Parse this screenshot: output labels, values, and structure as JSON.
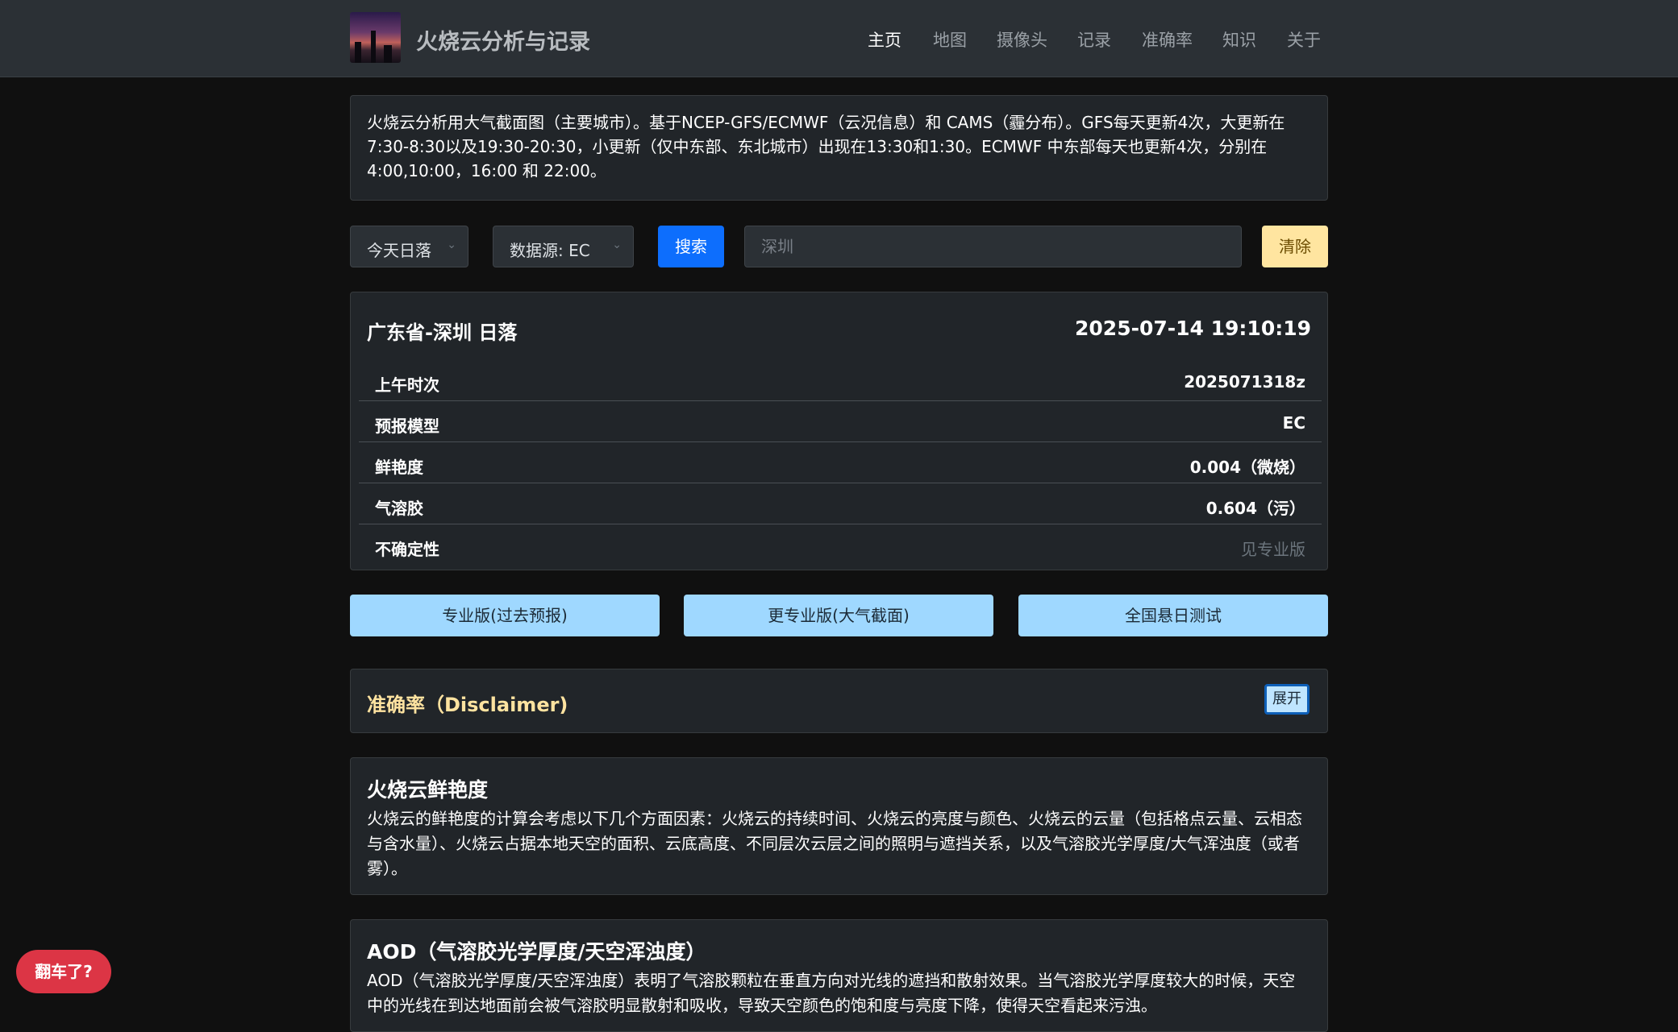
{
  "nav": {
    "brand": "火烧云分析与记录",
    "items": [
      "主页",
      "地图",
      "摄像头",
      "记录",
      "准确率",
      "知识",
      "关于"
    ],
    "active": "主页"
  },
  "intro": "火烧云分析用大气截面图（主要城市）。基于NCEP-GFS/ECMWF（云况信息）和 CAMS（霾分布）。GFS每天更新4次，大更新在7:30-8:30以及19:30-20:30，小更新（仅中东部、东北城市）出现在13:30和1:30。ECMWF 中东部每天也更新4次，分别在4:00,10:00，16:00 和 22:00。",
  "controls": {
    "event_select": "今天日落",
    "source_select": "数据源: EC",
    "search_button": "搜索",
    "search_placeholder": "深圳",
    "clear_button": "清除"
  },
  "result": {
    "title": "广东省-深圳 日落",
    "time": "2025-07-14 19:10:19",
    "rows": [
      {
        "label": "上午时次",
        "value": "2025071318z"
      },
      {
        "label": "预报模型",
        "value": "EC"
      },
      {
        "label": "鲜艳度",
        "value": "0.004（微烧）"
      },
      {
        "label": "气溶胶",
        "value": "0.604（污）"
      },
      {
        "label": "不确定性",
        "value": "见专业版"
      }
    ]
  },
  "actions": [
    "专业版(过去预报)",
    "更专业版(大气截面)",
    "全国悬日测试"
  ],
  "disclaimer": {
    "title": "准确率（Disclaimer)",
    "expand_button": "展开"
  },
  "sections": [
    {
      "title": "火烧云鲜艳度",
      "body": "火烧云的鲜艳度的计算会考虑以下几个方面因素：火烧云的持续时间、火烧云的亮度与颜色、火烧云的云量（包括格点云量、云相态与含水量）、火烧云占据本地天空的面积、云底高度、不同层次云层之间的照明与遮挡关系，以及气溶胶光学厚度/大气浑浊度（或者雾）。"
    },
    {
      "title": "AOD（气溶胶光学厚度/天空浑浊度）",
      "body": "AOD（气溶胶光学厚度/天空浑浊度）表明了气溶胶颗粒在垂直方向对光线的遮挡和散射效果。当气溶胶光学厚度较大的时候，天空中的光线在到达地面前会被气溶胶明显散射和吸收，导致天空颜色的饱和度与亮度下降，使得天空看起来污浊。"
    }
  ],
  "fab": "翻车了?",
  "colors": {
    "navbar_bg": "#2b3035",
    "card_bg": "#212529",
    "primary": "#0d6efd",
    "clear_btn": "#ffe5a0",
    "action_btn": "#9fd8ff",
    "disclaimer_title": "#ffe3a0",
    "fab": "#dc3545"
  }
}
